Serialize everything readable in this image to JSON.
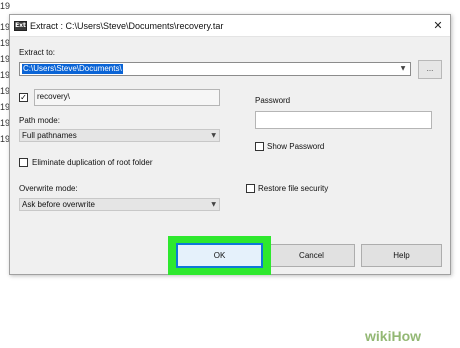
{
  "background": {
    "partial_lines": [
      "19",
      "19",
      "19",
      "19",
      "19",
      "19",
      "19",
      "19",
      "19"
    ]
  },
  "dialog": {
    "title": "Extract : C:\\Users\\Steve\\Documents\\recovery.tar",
    "app_icon_text": "Ext",
    "close_glyph": "✕",
    "extract_to": {
      "label": "Extract to:",
      "value": "C:\\Users\\Steve\\Documents\\",
      "browse_label": "..."
    },
    "subfolder": {
      "checked": true,
      "check_glyph": "✓",
      "value": "recovery\\"
    },
    "path_mode": {
      "label": "Path mode:",
      "selected": "Full pathnames"
    },
    "eliminate_duplication": {
      "label": "Eliminate duplication of root folder",
      "checked": false
    },
    "overwrite_mode": {
      "label": "Overwrite mode:",
      "selected": "Ask before overwrite"
    },
    "password": {
      "label": "Password",
      "value": ""
    },
    "show_password": {
      "label": "Show Password",
      "checked": false
    },
    "restore_security": {
      "label": "Restore file security",
      "checked": false
    },
    "buttons": {
      "ok": "OK",
      "cancel": "Cancel",
      "help": "Help"
    },
    "dropdown_glyph": "⌄"
  },
  "watermark": {
    "wiki": "wiki",
    "how": "How"
  },
  "colors": {
    "highlight": "#2ee82e",
    "selection": "#0a64d6",
    "ok_border": "#0f78d7"
  }
}
